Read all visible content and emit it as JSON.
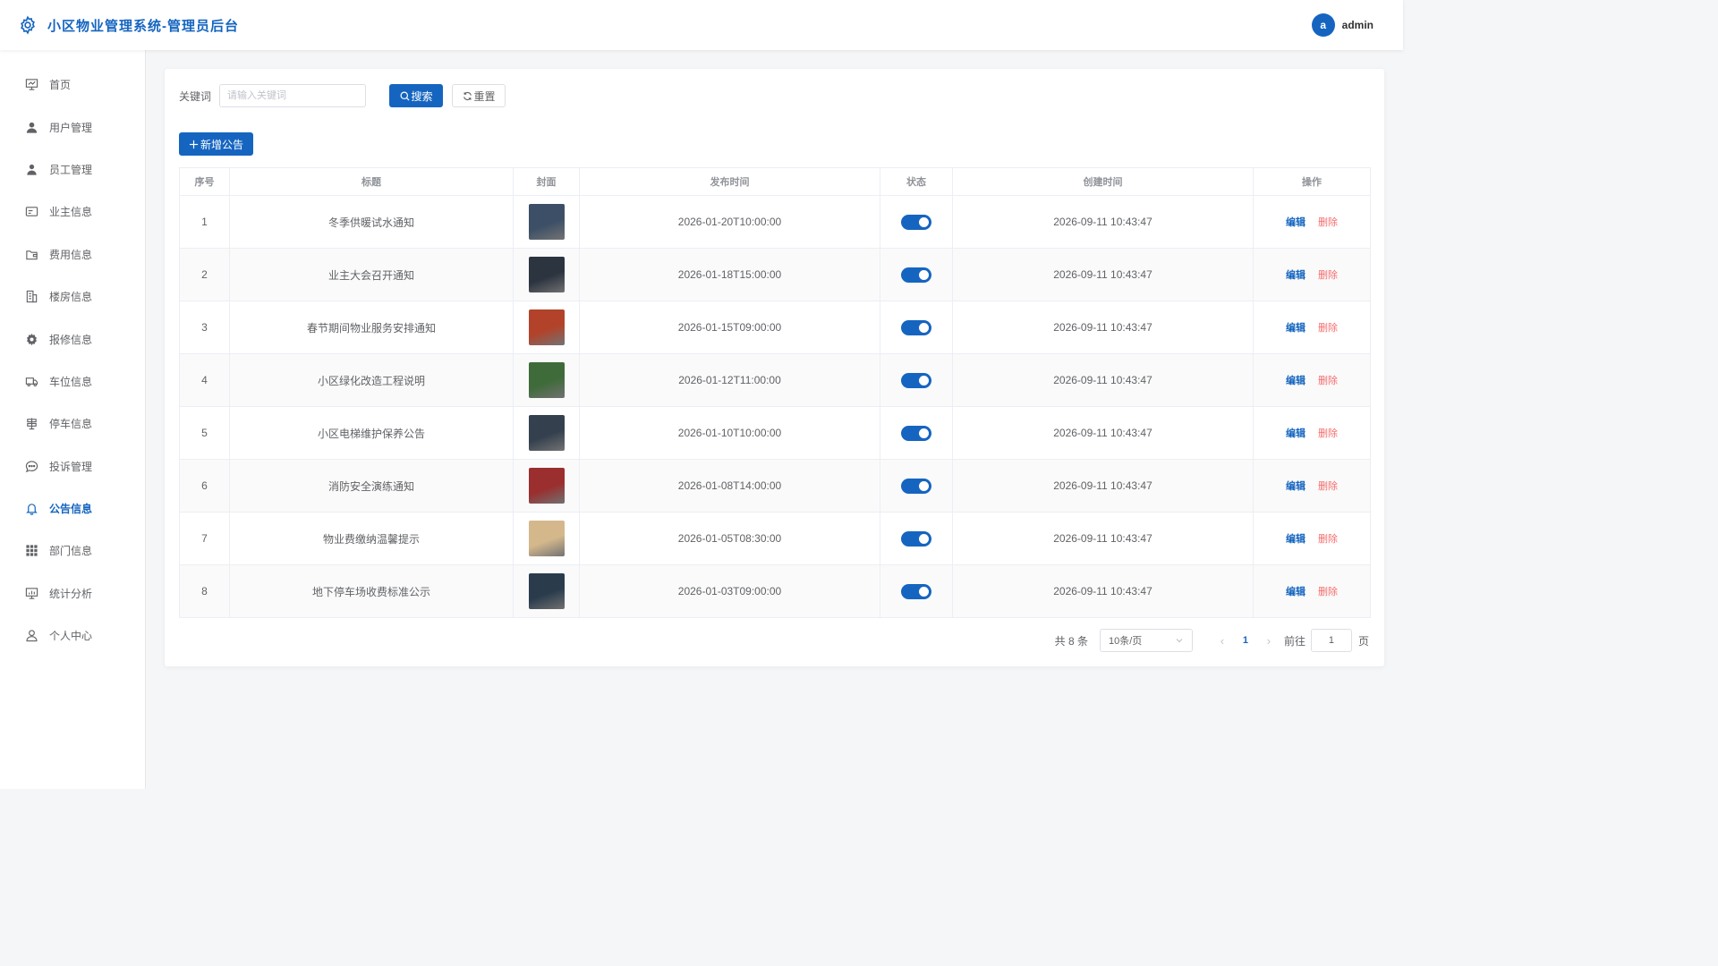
{
  "header": {
    "title": "小区物业管理系统-管理员后台",
    "avatar_letter": "a",
    "username": "admin"
  },
  "sidebar": {
    "items": [
      {
        "label": "首页",
        "icon": "dashboard-icon"
      },
      {
        "label": "用户管理",
        "icon": "user-icon"
      },
      {
        "label": "员工管理",
        "icon": "staff-icon"
      },
      {
        "label": "业主信息",
        "icon": "id-card-icon"
      },
      {
        "label": "费用信息",
        "icon": "wallet-icon"
      },
      {
        "label": "楼房信息",
        "icon": "building-icon"
      },
      {
        "label": "报修信息",
        "icon": "gear-icon"
      },
      {
        "label": "车位信息",
        "icon": "truck-icon"
      },
      {
        "label": "停车信息",
        "icon": "parking-sign-icon"
      },
      {
        "label": "投诉管理",
        "icon": "chat-icon"
      },
      {
        "label": "公告信息",
        "icon": "bell-icon",
        "active": true
      },
      {
        "label": "部门信息",
        "icon": "grid-icon"
      },
      {
        "label": "统计分析",
        "icon": "chart-icon"
      },
      {
        "label": "个人中心",
        "icon": "user-outline-icon"
      }
    ]
  },
  "search": {
    "label": "关键词",
    "placeholder": "请输入关键词",
    "search_label": "搜索",
    "reset_label": "重置"
  },
  "add_label": "新增公告",
  "table": {
    "headers": [
      "序号",
      "标题",
      "封面",
      "发布时间",
      "状态",
      "创建时间",
      "操作"
    ],
    "edit_label": "编辑",
    "delete_label": "删除",
    "rows": [
      {
        "index": "1",
        "title": "冬季供暖试水通知",
        "cover_color": "#3c4f66",
        "publish_time": "2026-01-20T10:00:00",
        "status": true,
        "created": "2026-09-11 10:43:47"
      },
      {
        "index": "2",
        "title": "业主大会召开通知",
        "cover_color": "#2c3440",
        "publish_time": "2026-01-18T15:00:00",
        "status": true,
        "created": "2026-09-11 10:43:47"
      },
      {
        "index": "3",
        "title": "春节期间物业服务安排通知",
        "cover_color": "#b2432a",
        "publish_time": "2026-01-15T09:00:00",
        "status": true,
        "created": "2026-09-11 10:43:47"
      },
      {
        "index": "4",
        "title": "小区绿化改造工程说明",
        "cover_color": "#3f6b3a",
        "publish_time": "2026-01-12T11:00:00",
        "status": true,
        "created": "2026-09-11 10:43:47"
      },
      {
        "index": "5",
        "title": "小区电梯维护保养公告",
        "cover_color": "#34404e",
        "publish_time": "2026-01-10T10:00:00",
        "status": true,
        "created": "2026-09-11 10:43:47"
      },
      {
        "index": "6",
        "title": "消防安全演练通知",
        "cover_color": "#9b2e2e",
        "publish_time": "2026-01-08T14:00:00",
        "status": true,
        "created": "2026-09-11 10:43:47"
      },
      {
        "index": "7",
        "title": "物业费缴纳温馨提示",
        "cover_color": "#d4b88c",
        "publish_time": "2026-01-05T08:30:00",
        "status": true,
        "created": "2026-09-11 10:43:47"
      },
      {
        "index": "8",
        "title": "地下停车场收费标准公示",
        "cover_color": "#2a3b4c",
        "publish_time": "2026-01-03T09:00:00",
        "status": true,
        "created": "2026-09-11 10:43:47"
      }
    ]
  },
  "pagination": {
    "total": "共 8 条",
    "page_size": "10条/页",
    "current": "1",
    "goto_prefix": "前往",
    "goto_value": "1",
    "goto_suffix": "页"
  },
  "colors": {
    "primary": "#1565c0",
    "danger": "#f56c6c"
  }
}
